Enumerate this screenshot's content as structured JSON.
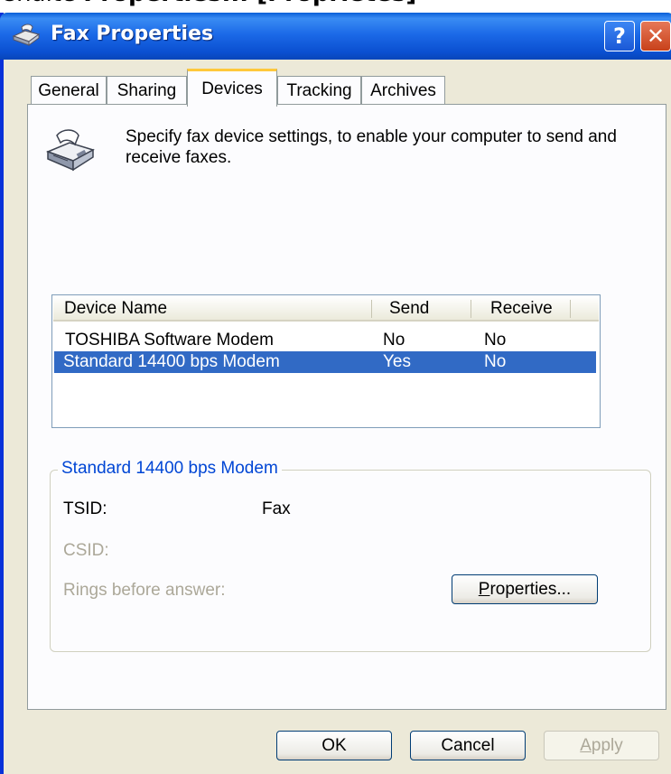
{
  "caption": {
    "prefix": "Chaite ",
    "bold": "Properties... [Propriétés]"
  },
  "window": {
    "title": "Fax Properties",
    "help_glyph": "?",
    "close_glyph": "✕"
  },
  "tabs": [
    {
      "label": "General"
    },
    {
      "label": "Sharing"
    },
    {
      "label": "Devices",
      "active": true
    },
    {
      "label": "Tracking"
    },
    {
      "label": "Archives"
    }
  ],
  "devices_tab": {
    "intro": "Specify fax device settings, to enable your computer to send and receive faxes.",
    "icon": "fax-machine-icon"
  },
  "device_list": {
    "columns": [
      "Device Name",
      "Send",
      "Receive"
    ],
    "rows": [
      {
        "name": "TOSHIBA Software Modem",
        "send": "No",
        "receive": "No",
        "selected": false
      },
      {
        "name": "Standard 14400 bps Modem",
        "send": "Yes",
        "receive": "No",
        "selected": true
      }
    ]
  },
  "device_details": {
    "group_title": "Standard 14400 bps Modem",
    "tsid_label": "TSID:",
    "tsid_value": "Fax",
    "csid_label": "CSID:",
    "rings_label": "Rings before answer:",
    "properties_button": "Properties..."
  },
  "footer": {
    "ok": "OK",
    "cancel": "Cancel",
    "apply": "Apply"
  },
  "colors": {
    "titlebar": "#0a4fd0",
    "selection": "#316ac5",
    "group_title": "#0046d5",
    "disabled_text": "#aca899"
  }
}
